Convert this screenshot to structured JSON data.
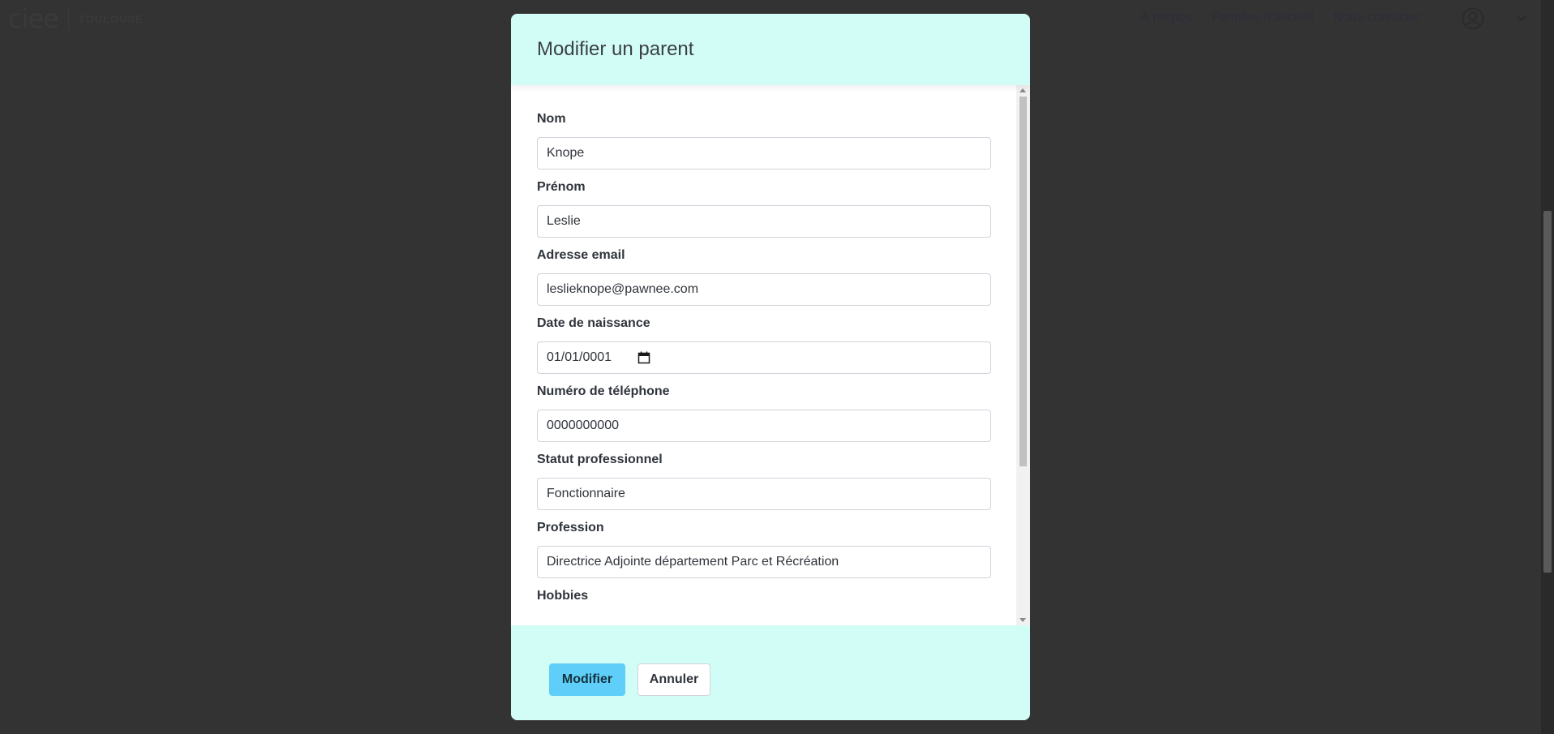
{
  "navbar": {
    "brand_logo": "ciee",
    "brand_city": "TOULOUSE",
    "links": [
      "À propos",
      "Familles d'accueil",
      "Nous contacter"
    ],
    "user_icon": "user-circle-icon",
    "caret_icon": "chevron-down-icon"
  },
  "modal": {
    "title": "Modifier un parent",
    "fields": {
      "nom": {
        "label": "Nom",
        "value": "Knope"
      },
      "prenom": {
        "label": "Prénom",
        "value": "Leslie"
      },
      "email": {
        "label": "Adresse email",
        "value": "leslieknope@pawnee.com"
      },
      "naissance": {
        "label": "Date de naissance",
        "value": "01/01/0001"
      },
      "telephone": {
        "label": "Numéro de téléphone",
        "value": "0000000000"
      },
      "statut": {
        "label": "Statut professionnel",
        "value": "Fonctionnaire"
      },
      "profession": {
        "label": "Profession",
        "value": "Directrice Adjointe département Parc et Récréation"
      },
      "hobbies": {
        "label": "Hobbies"
      }
    },
    "buttons": {
      "submit": "Modifier",
      "cancel": "Annuler"
    }
  },
  "colors": {
    "modal_header_bg": "#d2fcf6",
    "primary_button": "#5fcffa",
    "backdrop": "#333333"
  }
}
